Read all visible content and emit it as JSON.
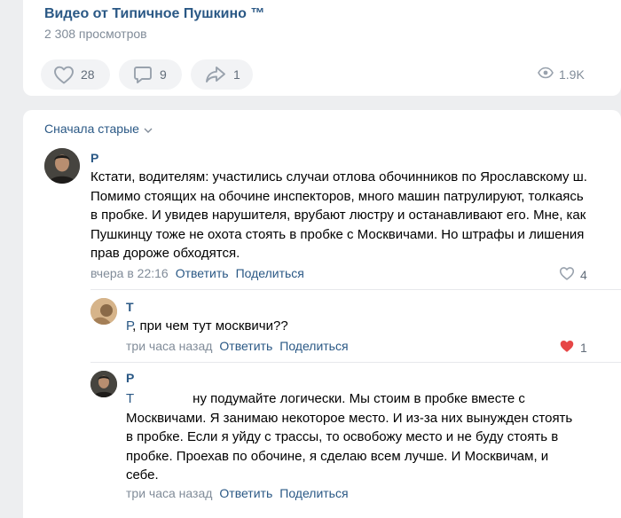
{
  "post": {
    "title": "Видео от Типичное Пушкино ™",
    "views": "2 308 просмотров",
    "likes": "28",
    "comments": "9",
    "shares": "1",
    "view_count": "1.9K"
  },
  "comments_sort": "Сначала старые",
  "comments": [
    {
      "author": "Р",
      "text": "Кстати, водителям: участились случаи отлова обочинников по Ярославскому ш. Помимо стоящих на обочине инспекторов, много машин патрулируют, толкаясь в пробке. И увидев нарушителя, врубают люстру и останавливают его. Мне, как Пушкинцу тоже не охота стоять в пробке с Москвичами. Но штрафы и лишения прав дороже обходятся.",
      "time": "вчера в 22:16",
      "reply": "Ответить",
      "share": "Поделиться",
      "likes": "4"
    },
    {
      "author": "Т",
      "mention": "Р",
      "text": ", при чем тут москвичи??",
      "time": "три часа назад",
      "reply": "Ответить",
      "share": "Поделиться",
      "likes": "1"
    },
    {
      "author": "Р",
      "mention": "Т",
      "text": "ну подумайте логически. Мы стоим в пробке вместе с Москвичами. Я занимаю некоторое место. И из-за них вынужден стоять в пробке. Если я уйду с трассы, то освобожу место и не буду стоять в пробке. Проехав по обочине, я сделаю всем лучше. И Москвичам, и себе.",
      "time": "три часа назад",
      "reply": "Ответить",
      "share": "Поделиться"
    }
  ],
  "colors": {
    "link": "#2a5885",
    "muted": "#818c99",
    "liked_heart": "#e64646",
    "background": "#edeef0"
  },
  "icons": [
    "heart-icon",
    "comment-icon",
    "share-icon",
    "eye-icon",
    "chevron-down-icon"
  ]
}
